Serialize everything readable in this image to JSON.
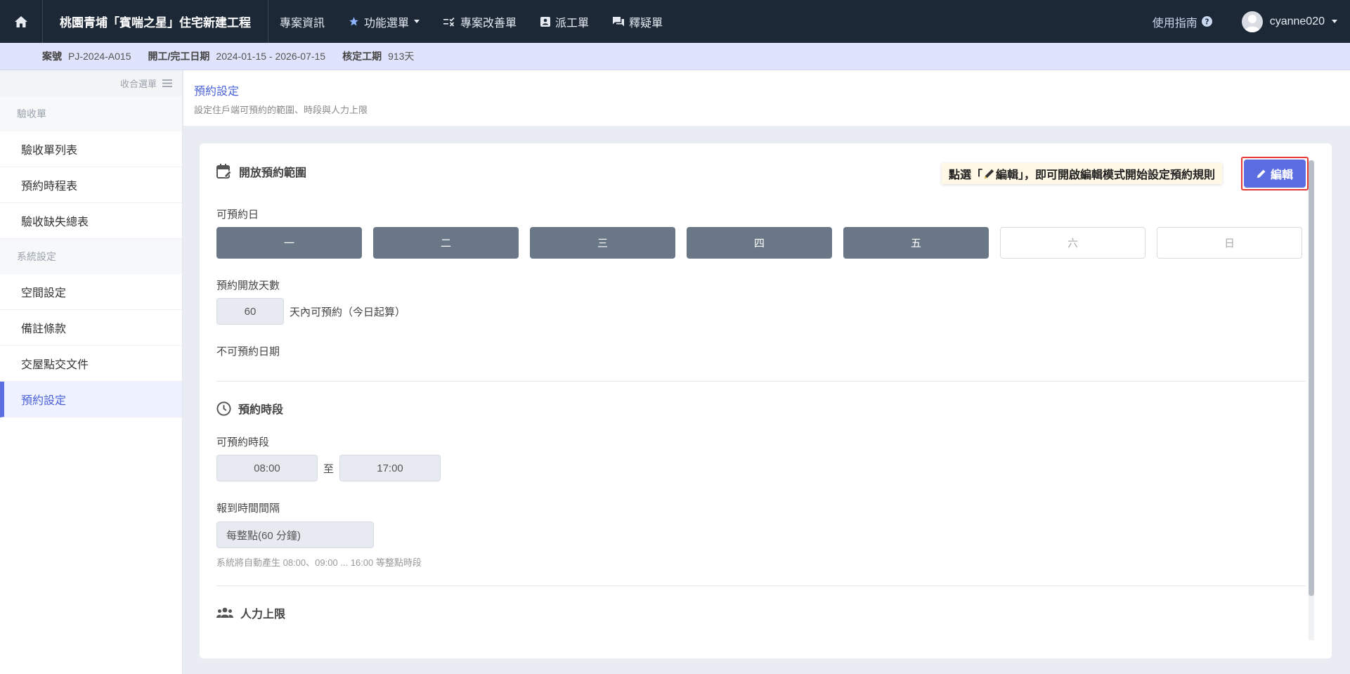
{
  "topbar": {
    "project_title": "桃園青埔「賓喘之星」住宅新建工程",
    "nav": [
      {
        "label": "專案資訊"
      },
      {
        "label": "功能選單"
      },
      {
        "label": "專案改善單"
      },
      {
        "label": "派工單"
      },
      {
        "label": "釋疑單"
      }
    ],
    "guide_label": "使用指南",
    "username": "cyanne020"
  },
  "infobar": {
    "case_key": "案號",
    "case_val": "PJ-2024-A015",
    "date_key": "開工/完工日期",
    "date_val": "2024-01-15 - 2026-07-15",
    "period_key": "核定工期",
    "period_val": "913天"
  },
  "sidebar": {
    "collapse_label": "收合選單",
    "sections": [
      {
        "title": "驗收單",
        "items": [
          "驗收單列表",
          "預約時程表",
          "驗收缺失總表"
        ]
      },
      {
        "title": "系統設定",
        "items": [
          "空間設定",
          "備註條款",
          "交屋點交文件",
          "預約設定"
        ]
      }
    ]
  },
  "page": {
    "title": "預約設定",
    "description": "設定住戶端可預約的範圍、時段與人力上限"
  },
  "open_range": {
    "title": "開放預約範圍",
    "days_label": "可預約日",
    "days": [
      {
        "label": "一",
        "on": true
      },
      {
        "label": "二",
        "on": true
      },
      {
        "label": "三",
        "on": true
      },
      {
        "label": "四",
        "on": true
      },
      {
        "label": "五",
        "on": true
      },
      {
        "label": "六",
        "on": false
      },
      {
        "label": "日",
        "on": false
      }
    ],
    "open_days_label": "預約開放天數",
    "open_days_value": "60",
    "open_days_suffix": "天內可預約（今日起算）",
    "blocked_label": "不可預約日期"
  },
  "slots": {
    "title": "預約時段",
    "range_label": "可預約時段",
    "start": "08:00",
    "to": "至",
    "end": "17:00",
    "interval_label": "報到時間間隔",
    "interval_value": "每整點(60 分鐘)",
    "hint": "系統將自動產生 08:00、09:00 ... 16:00 等整點時段"
  },
  "manpower": {
    "title": "人力上限"
  },
  "tooltip": {
    "prefix": "點選「",
    "edit_word": "編輯",
    "suffix": "」，即可開啟編輯模式開始設定預約規則"
  },
  "edit_button_label": "編輯",
  "colors": {
    "topbar": "#1c2836",
    "accent": "#5b6de0",
    "day_on": "#6a7786",
    "highlight": "#e53935"
  }
}
